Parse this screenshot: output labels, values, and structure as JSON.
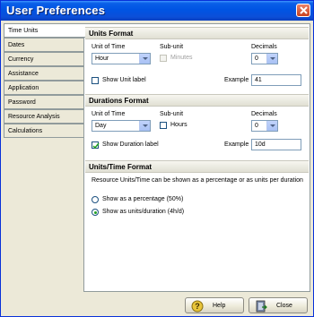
{
  "window": {
    "title": "User Preferences"
  },
  "tabs": [
    {
      "label": "Time Units",
      "active": true
    },
    {
      "label": "Dates"
    },
    {
      "label": "Currency"
    },
    {
      "label": "Assistance"
    },
    {
      "label": "Application"
    },
    {
      "label": "Password"
    },
    {
      "label": "Resource Analysis"
    },
    {
      "label": "Calculations"
    }
  ],
  "units_format": {
    "heading": "Units Format",
    "unit_of_time_label": "Unit of Time",
    "unit_of_time_value": "Hour",
    "subunit_label": "Sub-unit",
    "subunit_option": "Minutes",
    "decimals_label": "Decimals",
    "decimals_value": "0",
    "show_unit_label": "Show Unit label",
    "show_unit_checked": false,
    "example_label": "Example",
    "example_value": "41"
  },
  "durations_format": {
    "heading": "Durations Format",
    "unit_of_time_label": "Unit of Time",
    "unit_of_time_value": "Day",
    "subunit_label": "Sub-unit",
    "subunit_option": "Hours",
    "decimals_label": "Decimals",
    "decimals_value": "0",
    "show_duration_label": "Show Duration label",
    "show_duration_checked": true,
    "example_label": "Example",
    "example_value": "10d"
  },
  "units_time_format": {
    "heading": "Units/Time Format",
    "description": "Resource Units/Time can be shown as a percentage or as units per duration",
    "option_percentage": "Show as a percentage (50%)",
    "option_units": "Show as units/duration (4h/d)",
    "selected": "units"
  },
  "footer": {
    "help_label": "Help",
    "close_label": "Close"
  },
  "colors": {
    "titlebar": "#0054e3",
    "check": "#21a121",
    "border": "#919b9c"
  }
}
